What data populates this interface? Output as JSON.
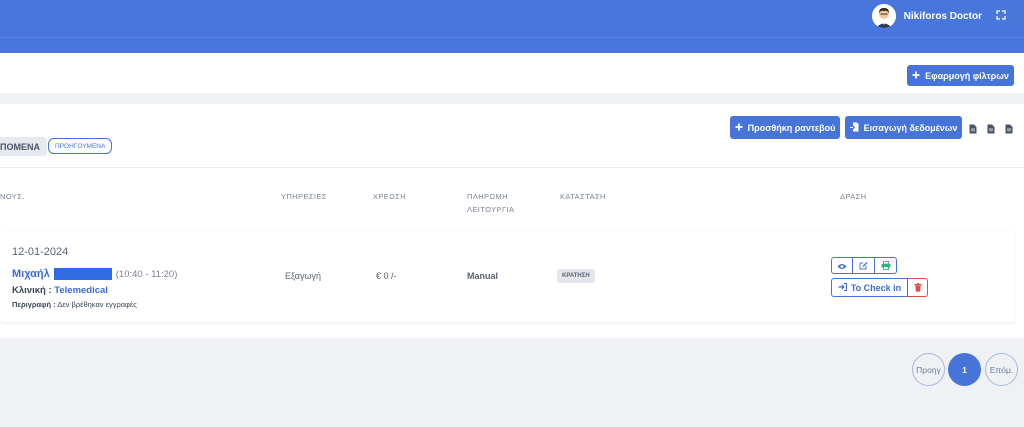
{
  "header": {
    "user_name": "Nikiforos Doctor",
    "avatar_icon": "doctor-avatar-icon",
    "fullscreen_icon": "fullscreen-icon"
  },
  "filters": {
    "apply_label": "Εφαρμογή φίλτρων",
    "apply_icon": "plus-icon"
  },
  "toolbar": {
    "add_label": "Προσθήκη ραντεβού",
    "export_label": "Εισαγωγή δεδομένων",
    "doc_icons": [
      "document-icon",
      "document-icon",
      "document-icon"
    ]
  },
  "tabs": {
    "upcoming": "ΠΟΜΕΝΑ",
    "past": "ΠΡΟΗΓΟΥΜΕΝΑ"
  },
  "table": {
    "headers": {
      "patient": "ΝΟΥΣ.",
      "services": "ΥΠΗΡΕΣΙΕΣ",
      "charge": "ΧΡΕΩΣΗ",
      "payment_line1": "ΠΛΗΡΩΜΗ",
      "payment_line2": "ΛΕΙΤΟΥΡΓΙΑ",
      "status": "ΚΑΤΑΣΤΑΣΗ",
      "action": "ΔΡΑΣΗ"
    },
    "rows": [
      {
        "date": "12-01-2024",
        "patient_name": "Μιχαήλ",
        "time": "(10:40 - 11:20)",
        "clinic_label": "Κλινική :",
        "clinic_value": "Telemedical",
        "description_label": "Περιγραφή :",
        "description_value": "Δεν βρέθηκαν εγγραφές",
        "service": "Εξαγωγή",
        "charge": "€ 0 /-",
        "payment": "Manual",
        "status": "ΚΡΑΤΗΣΗ",
        "checkin_label": "To Check in"
      }
    ]
  },
  "pagination": {
    "prev": "Προηγ",
    "current": "1",
    "next": "Επόμ."
  },
  "colors": {
    "primary": "#4674d8",
    "header": "#4976dd",
    "danger": "#e34a4a",
    "success": "#2fb57a"
  }
}
